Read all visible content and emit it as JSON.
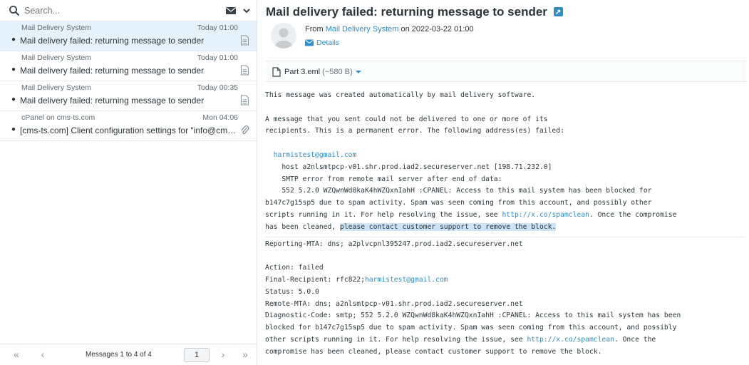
{
  "search": {
    "placeholder": "Search..."
  },
  "messages": [
    {
      "sender": "Mail Delivery System",
      "date": "Today 01:00",
      "subject": "Mail delivery failed: returning message to sender",
      "selected": true
    },
    {
      "sender": "Mail Delivery System",
      "date": "Today 01:00",
      "subject": "Mail delivery failed: returning message to sender",
      "selected": false
    },
    {
      "sender": "Mail Delivery System",
      "date": "Today 00:35",
      "subject": "Mail delivery failed: returning message to sender",
      "selected": false
    },
    {
      "sender": "cPanel on cms-ts.com",
      "date": "Mon 04:06",
      "subject": "[cms-ts.com] Client configuration settings for \"info@cms-ts....",
      "selected": false
    }
  ],
  "pager": {
    "first": "«",
    "prev": "‹",
    "info": "Messages 1 to 4 of 4",
    "page": "1",
    "next": "›",
    "last": "»"
  },
  "mail": {
    "title": "Mail delivery failed: returning message to sender",
    "from_prefix": "From ",
    "from_name": "Mail Delivery System",
    "from_suffix": " on 2022-03-22 01:00",
    "details": "Details",
    "attachment_name": "Part 3.eml",
    "attachment_size": "(~580 B)"
  },
  "body": {
    "l1": "This message was created automatically by mail delivery software.",
    "l2": "A message that you sent could not be delivered to one or more of its",
    "l3": "recipients. This is a permanent error. The following address(es) failed:",
    "addr": "harmistest@gmail.com",
    "l5": "    host a2nlsmtpcp-v01.shr.prod.iad2.secureserver.net [198.71.232.0]",
    "l6": "    SMTP error from remote mail server after end of data:",
    "l7": "    552 5.2.0 WZQwnWd8kaK4hWZQxnIahH :CPANEL: Access to this mail system has been blocked for",
    "l8": "b147c7g15sp5 due to spam activity. Spam was seen coming from this account, and possibly other",
    "l9a": "scripts running in it. For help resolving the issue, see ",
    "link": "http://x.co/spamclean",
    "l9b": ". Once the compromise",
    "l10a": "has been cleaned, ",
    "l10hl": "please contact customer support to remove the block.",
    "r1": "Reporting-MTA: dns; a2plvcpnl395247.prod.iad2.secureserver.net",
    "r2": "Action: failed",
    "r3a": "Final-Recipient: rfc822;",
    "r3b": "harmistest@gmail.com",
    "r4": "Status: 5.0.0",
    "r5": "Remote-MTA: dns; a2nlsmtpcp-v01.shr.prod.iad2.secureserver.net",
    "r6": "Diagnostic-Code: smtp; 552 5.2.0 WZQwnWd8kaK4hWZQxnIahH :CPANEL: Access to this mail system has been",
    "r7": "blocked for b147c7g15sp5 due to spam activity. Spam was seen coming from this account, and possibly",
    "r8a": "other scripts running in it. For help resolving the issue, see ",
    "r8link": "http://x.co/spamclean",
    "r8b": ". Once the",
    "r9": "compromise has been cleaned, please contact customer support to remove the block."
  },
  "colors": {
    "accent": "#2f8ec5",
    "selected_row": "#e6f2fb",
    "highlight": "#cde3f6"
  }
}
